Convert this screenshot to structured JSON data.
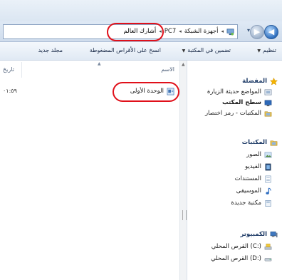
{
  "address": {
    "crumbs": [
      "أجهزة الشبكة",
      "PC7",
      "أشارك العالم"
    ],
    "separator": "◂"
  },
  "toolbar": {
    "organize": "تنظيم",
    "include_in_library": "تضمين في المكتبة",
    "burn": "انسخ على الأقراص المضغوطة",
    "new_folder": "مجلد جديد"
  },
  "columns": {
    "name": "الاسم",
    "date": "تاريخ"
  },
  "files": [
    {
      "name": "الوحدة الأولى",
      "date": "٠١:٥٩"
    }
  ],
  "navpane": {
    "favorites": {
      "title": "المفضلة",
      "items": [
        "المواضع حديثة الزيارة",
        "سطح المكتب",
        "المكتبات - رمز اختصار"
      ]
    },
    "libraries": {
      "title": "المكتبات",
      "items": [
        "الصور",
        "الفيديو",
        "المستندات",
        "الموسيقى",
        "مكتبة جديدة"
      ]
    },
    "computer": {
      "title": "الكمبيوتر",
      "items": [
        "القرص المحلي (C:)",
        "القرص المحلي (D:)"
      ]
    }
  },
  "colors": {
    "highlight_ring": "#e0101a",
    "star": "#f5b400",
    "folder": "#e8c04a"
  }
}
